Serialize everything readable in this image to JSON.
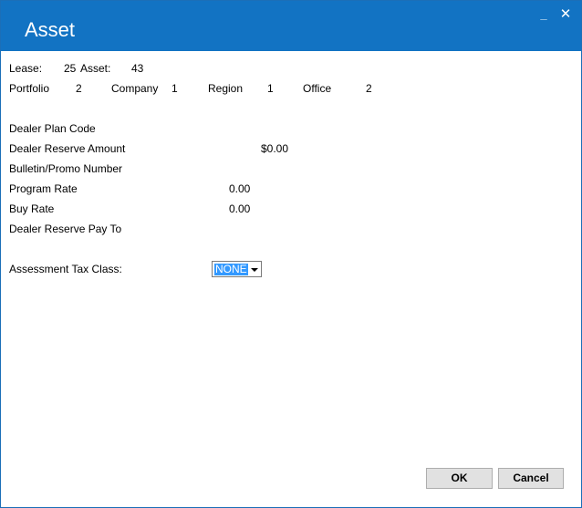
{
  "window": {
    "title": "Asset"
  },
  "header": {
    "lease_label": "Lease:",
    "lease_value": "25",
    "asset_label": "Asset:",
    "asset_value": "43",
    "portfolio_label": "Portfolio",
    "portfolio_value": "2",
    "company_label": "Company",
    "company_value": "1",
    "region_label": "Region",
    "region_value": "1",
    "office_label": "Office",
    "office_value": "2"
  },
  "fields": {
    "dealer_plan_code_label": "Dealer Plan Code",
    "dealer_reserve_amount_label": "Dealer Reserve Amount",
    "dealer_reserve_amount_value": "$0.00",
    "bulletin_promo_label": "Bulletin/Promo Number",
    "program_rate_label": "Program Rate",
    "program_rate_value": "0.00",
    "buy_rate_label": "Buy Rate",
    "buy_rate_value": "0.00",
    "dealer_reserve_pay_to_label": "Dealer Reserve Pay To",
    "assessment_tax_class_label": "Assessment Tax Class:",
    "assessment_tax_class_value": "NONE"
  },
  "buttons": {
    "ok": "OK",
    "cancel": "Cancel"
  },
  "icons": {
    "minimize": "minimize-icon",
    "close": "close-icon",
    "dropdown": "chevron-down-icon"
  },
  "colors": {
    "titlebar": "#1273c3",
    "selection": "#3399ff",
    "button": "#e1e1e1"
  }
}
